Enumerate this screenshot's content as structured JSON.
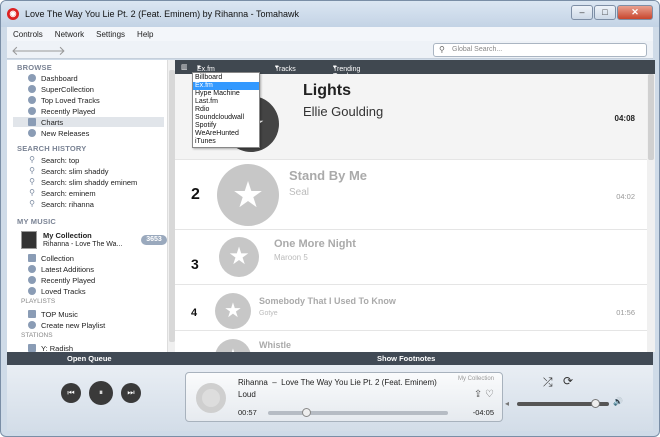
{
  "window": {
    "title": "Love The Way You Lie Pt. 2 (Feat. Eminem) by Rihanna - Tomahawk",
    "min": "–",
    "max": "□",
    "close": "✕"
  },
  "menu": [
    "Controls",
    "Network",
    "Settings",
    "Help"
  ],
  "toolbar": {
    "back": "🡐",
    "forward": "🡒",
    "search_placeholder": "Global Search..."
  },
  "sidebar": {
    "browse_header": "BROWSE",
    "browse": [
      {
        "label": "Dashboard",
        "icon": "dashboard-icon"
      },
      {
        "label": "SuperCollection",
        "icon": "supercollection-icon"
      },
      {
        "label": "Top Loved Tracks",
        "icon": "heart-icon"
      },
      {
        "label": "Recently Played",
        "icon": "clock-icon"
      },
      {
        "label": "Charts",
        "icon": "charts-icon"
      },
      {
        "label": "New Releases",
        "icon": "new-releases-icon"
      }
    ],
    "history_header": "SEARCH HISTORY",
    "history": [
      "Search: top",
      "Search: slim shaddy",
      "Search: slim shaddy eminem",
      "Search: eminem",
      "Search: rihanna"
    ],
    "mymusic_header": "MY MUSIC",
    "collection": {
      "title": "My Collection",
      "subtitle": "Rihanna - Love The Wa...",
      "count": "3653"
    },
    "mymusic": [
      "Collection",
      "Latest Additions",
      "Recently Played",
      "Loved Tracks"
    ],
    "playlists_header": "PLAYLISTS",
    "playlists": [
      "TOP Music",
      "Create new Playlist"
    ],
    "stations_header": "STATIONS",
    "stations": [
      "Y: Radish"
    ]
  },
  "charts": {
    "source": "Ex.fm",
    "type": "Tracks",
    "list": "Trending Tracks",
    "dropdown": [
      "Billboard",
      "Ex.fm",
      "Hype Machine",
      "Last.fm",
      "Rdio",
      "Soundcloudwall",
      "Spotify",
      "WeAreHunted",
      "iTunes"
    ],
    "dropdown_selected": 1,
    "tracks": [
      {
        "rank": "",
        "title": "Lights",
        "artist": "Ellie Goulding",
        "duration": "04:08"
      },
      {
        "rank": "2",
        "title": "Stand By Me",
        "artist": "Seal",
        "duration": "04:02"
      },
      {
        "rank": "3",
        "title": "One More Night",
        "artist": "Maroon 5",
        "duration": ""
      },
      {
        "rank": "4",
        "title": "Somebody That I Used To Know",
        "artist": "Gotye",
        "duration": "01:56"
      },
      {
        "rank": "",
        "title": "Whistle",
        "artist": "",
        "duration": ""
      }
    ]
  },
  "footer": {
    "left": "Open Queue",
    "right": "Show Footnotes"
  },
  "player": {
    "prev": "⏮",
    "pause": "⏸",
    "next": "⏭",
    "artist": "Rihanna",
    "separator": "–",
    "track": "Love The Way You Lie Pt. 2 (Feat. Eminem)",
    "album": "Loud",
    "source": "My Collection",
    "elapsed": "00:57",
    "remaining": "-04:05",
    "progress": 0.19,
    "volume": 0.85,
    "shuffle": "⤮",
    "repeat": "⟳",
    "vol_low": "◂",
    "vol_high": "🔊"
  }
}
